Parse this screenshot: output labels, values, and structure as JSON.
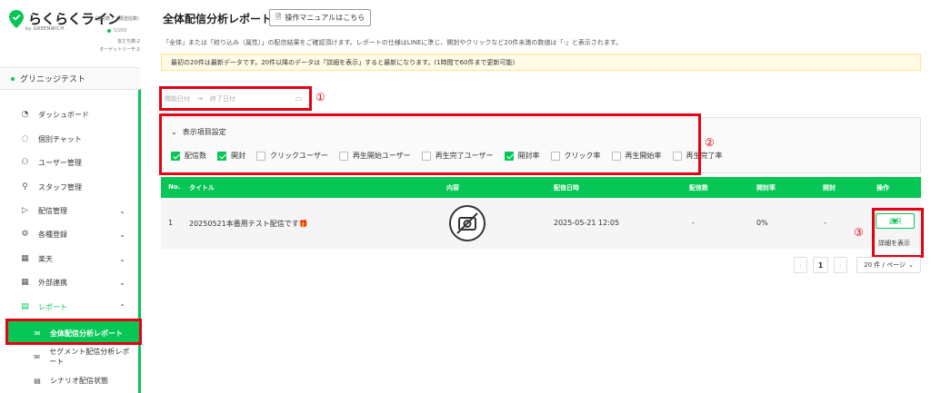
{
  "brand": {
    "name": "らくらくライン",
    "by": "by GREENWICH",
    "quota_label": "(送信数 / 上限送信数)",
    "quota_value": "5/200",
    "friends": "友だち数:2",
    "target_reach": "ターゲットリーチ:2"
  },
  "account": {
    "name": "グリニッジテスト"
  },
  "sidebar": {
    "items": [
      {
        "label": "ダッシュボード",
        "icon": "dashboard-icon",
        "glyph": "◔"
      },
      {
        "label": "個別チャット",
        "icon": "chat-icon",
        "glyph": "◌"
      },
      {
        "label": "ユーザー管理",
        "icon": "users-icon",
        "glyph": "⚇"
      },
      {
        "label": "スタッフ管理",
        "icon": "staff-icon",
        "glyph": "⚲"
      },
      {
        "label": "配信管理",
        "icon": "send-icon",
        "glyph": "▷",
        "chevron": "⌄"
      },
      {
        "label": "各種登録",
        "icon": "settings-icon",
        "glyph": "⚙",
        "chevron": "⌄"
      },
      {
        "label": "楽天",
        "icon": "rakuten-icon",
        "glyph": "▦",
        "chevron": "⌄"
      },
      {
        "label": "外部連携",
        "icon": "integration-icon",
        "glyph": "▦",
        "chevron": "⌄"
      },
      {
        "label": "レポート",
        "icon": "report-icon",
        "glyph": "▤",
        "chevron": "⌃"
      }
    ],
    "sub_items": [
      {
        "label": "全体配信分析レポート",
        "icon": "mail-icon",
        "glyph": "✉"
      },
      {
        "label": "セグメント配信分析レポート",
        "icon": "mail-icon",
        "glyph": "✉"
      },
      {
        "label": "シナリオ配信状態",
        "icon": "scenario-icon",
        "glyph": "▤"
      }
    ]
  },
  "page": {
    "title": "全体配信分析レポート",
    "manual_button": "操作マニュアルはこちら",
    "description": "「全体」または「絞り込み（属性）」の配信結果をご確認頂けます。レポートの仕様はLINEに準じ、開封やクリックなど20件未満の数値は「-」と表示されます。",
    "notice": "最初の20件は最新データです。20件以降のデータは「詳細を表示」すると最新になります。(1時間で60件まで更新可能)"
  },
  "date_range": {
    "start_placeholder": "開始日付",
    "arrow": "→",
    "end_placeholder": "終了日付"
  },
  "annotations": {
    "one": "①",
    "two": "②",
    "three": "③"
  },
  "settings": {
    "header": "表示項目設定",
    "chevron": "⌄",
    "options": [
      {
        "label": "配信数",
        "checked": true
      },
      {
        "label": "開封",
        "checked": true
      },
      {
        "label": "クリックユーザー",
        "checked": false
      },
      {
        "label": "再生開始ユーザー",
        "checked": false
      },
      {
        "label": "再生完了ユーザー",
        "checked": false
      },
      {
        "label": "開封率",
        "checked": true
      },
      {
        "label": "クリック率",
        "checked": false
      },
      {
        "label": "再生開始率",
        "checked": false
      },
      {
        "label": "再生完了率",
        "checked": false
      }
    ]
  },
  "table": {
    "headers": {
      "no": "No.",
      "title": "タイトル",
      "content": "内容",
      "date": "配信日時",
      "count": "配信数",
      "open_rate": "開封率",
      "open": "開封",
      "action": "操作"
    },
    "rows": [
      {
        "no": "1",
        "title": "20250521本番用テスト配信です🎁",
        "date": "2025-05-21 12:05",
        "count": "-",
        "open_rate": "0%",
        "open": "-",
        "select": "選択",
        "detail": "詳細を表示"
      }
    ]
  },
  "pagination": {
    "prev": "‹",
    "page": "1",
    "next": "›",
    "per_page": "20 件 / ページ",
    "per_page_chevron": "⌄"
  },
  "colors": {
    "accent": "#06c755",
    "annotation_red": "#e60012",
    "notice_bg": "#fffbe6"
  }
}
